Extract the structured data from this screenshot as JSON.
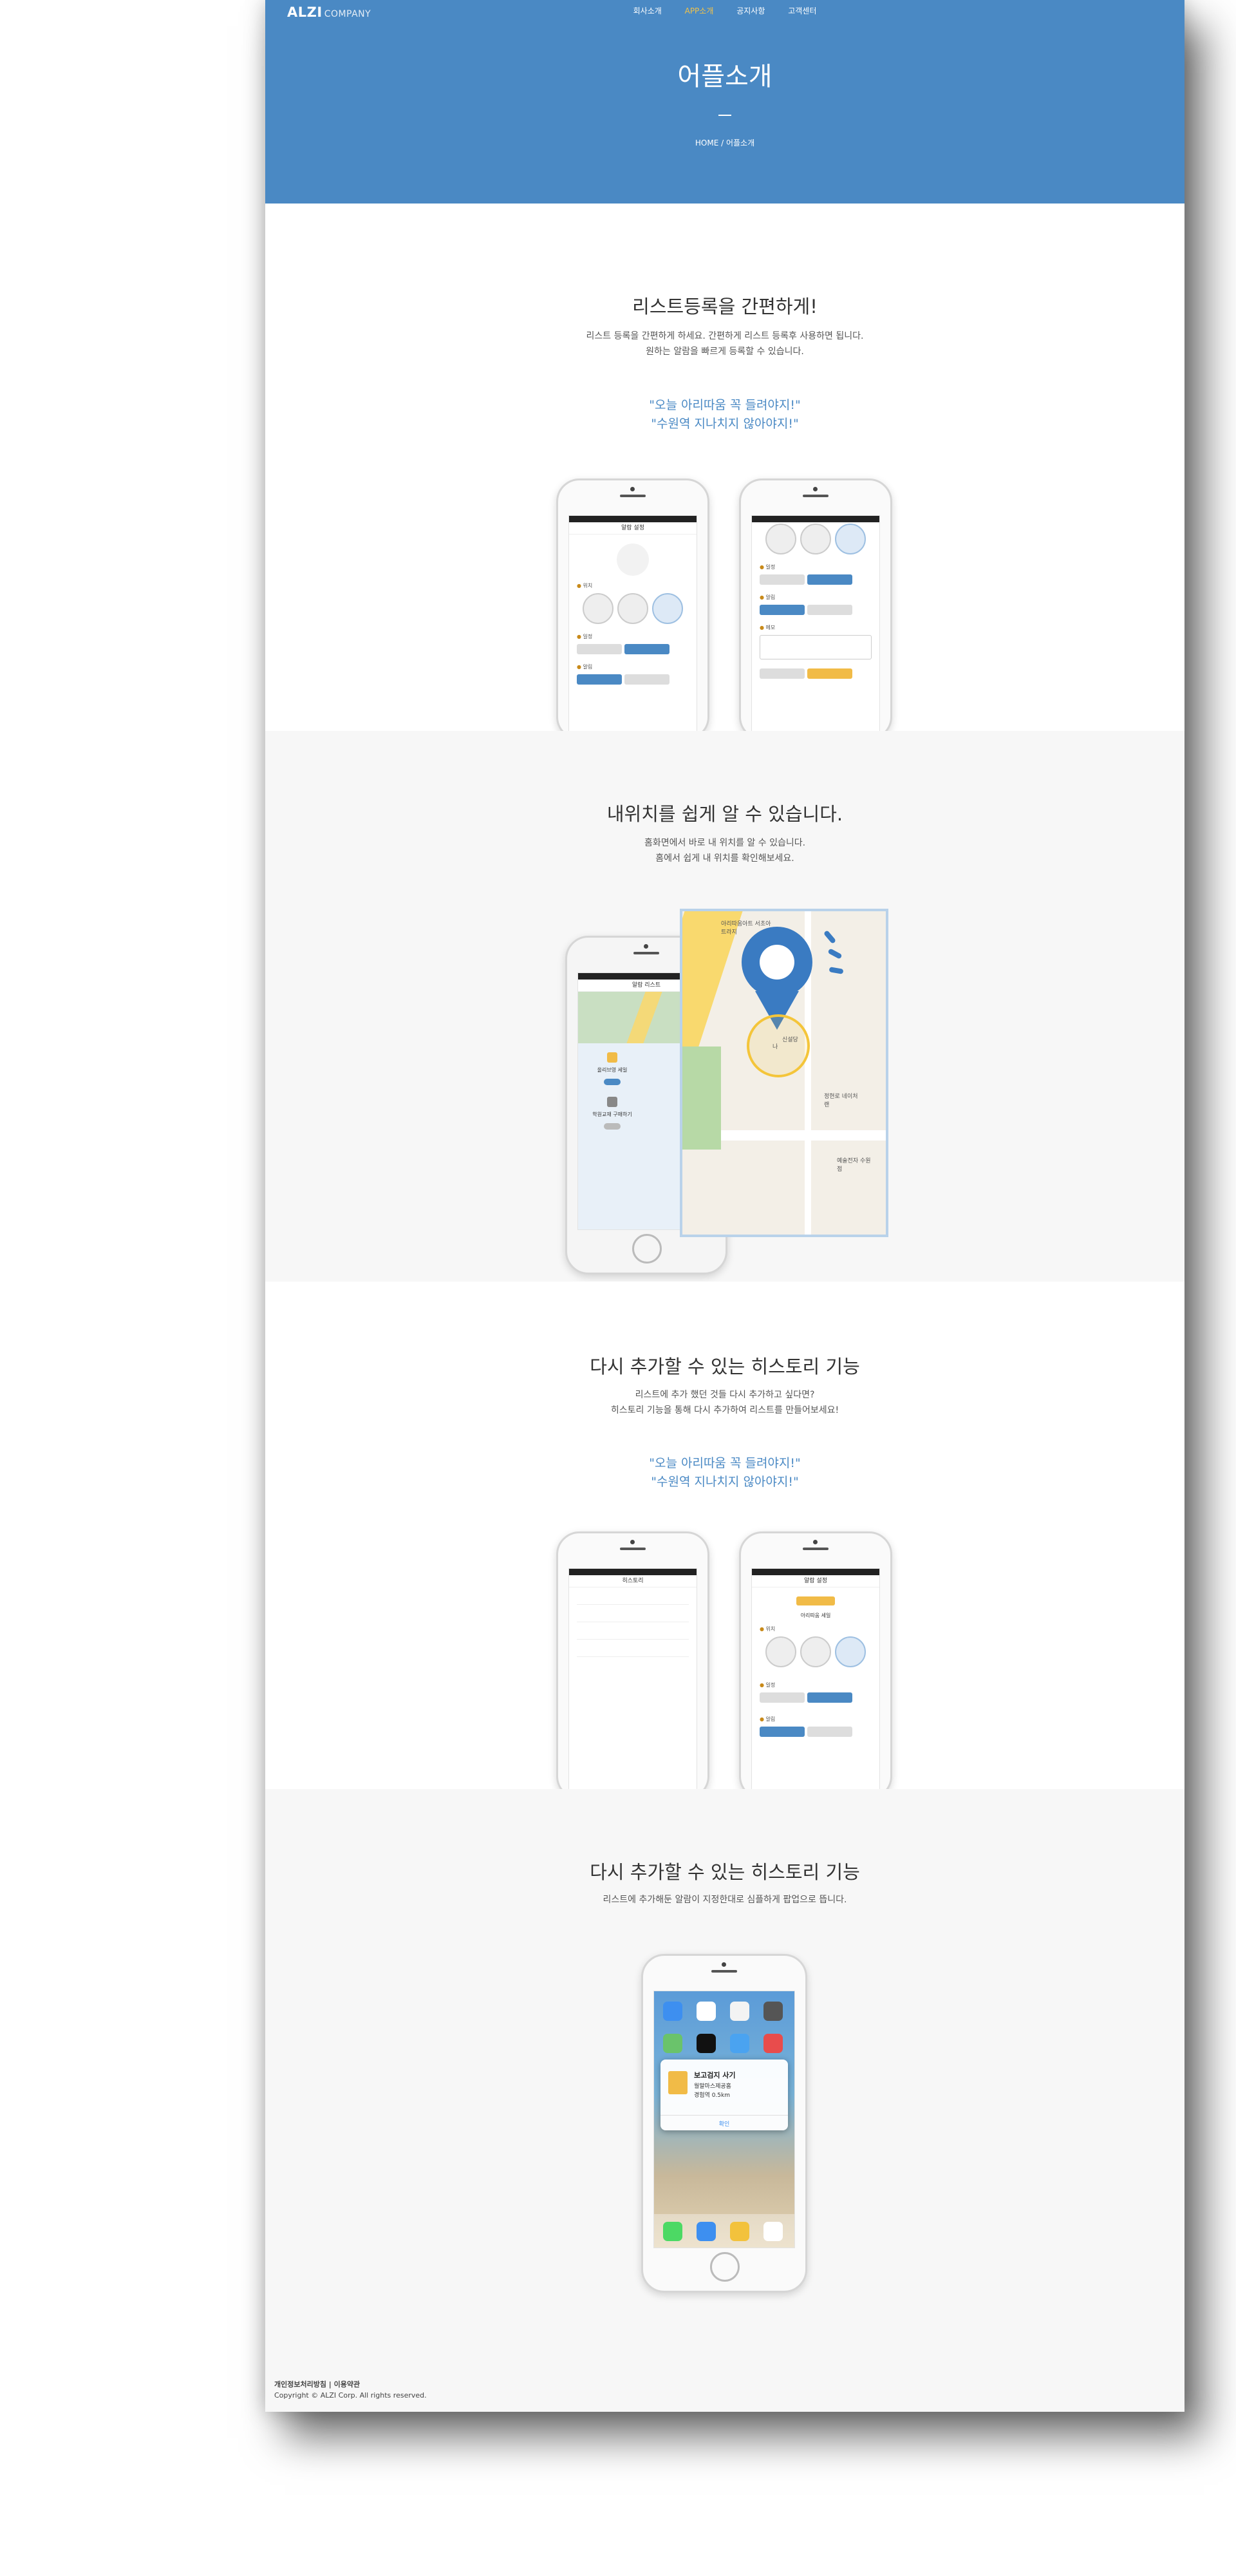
{
  "header": {
    "logo": "ALZI",
    "logo_sub": "COMPANY",
    "nav": [
      "회사소개",
      "APP소개",
      "공지사항",
      "고객센터"
    ],
    "active_nav_index": 1,
    "title": "어플소개",
    "breadcrumb": "HOME / 어플소개"
  },
  "colors": {
    "primary": "#4a89c4",
    "accent": "#f0c24b",
    "section_alt_bg": "#f7f7f7"
  },
  "section1": {
    "title": "리스트등록을 간편하게!",
    "desc_line1": "리스트 등록을 간편하게 하세요. 간편하게 리스트 등록후 사용하면 됩니다.",
    "desc_line2": "원하는 알람을 빠르게 등록할 수 있습니다.",
    "quote_line1": "\"오늘 아리따움 꼭 들려야지!\"",
    "quote_line2": "\"수원역 지나치지 않아야지!\"",
    "phone1_title": "알람 설정"
  },
  "section2": {
    "title": "내위치를 쉽게 알 수 있습니다.",
    "desc_line1": "홈화면에서 바로 내 위치를 알 수 있습니다.",
    "desc_line2": "홈에서 쉽게 내 위치를 확인해보세요.",
    "phone_title": "알람 리스트",
    "list_item1": "올리브영 세일",
    "list_item2": "학원교재 구매하기",
    "map_label_top": "아리따움아트 서초아트라지",
    "map_label_me": "나",
    "map_label_mid": "신설당",
    "map_label_right1": "정현로 네이처랜",
    "map_label_right2": "예술전자 수원점"
  },
  "section3": {
    "title": "다시 추가할 수 있는 히스토리 기능",
    "desc_line1": "리스트에 추가 했던 것들 다시 추가하고 싶다면?",
    "desc_line2": "히스토리 기능을 통해 다시 추가하여 리스트를 만들어보세요!",
    "quote_line1": "\"오늘 아리따움 꼭 들려야지!\"",
    "quote_line2": "\"수원역 지나치지 않아야지!\"",
    "phone1_title": "히스토리",
    "phone2_title": "알람 설정",
    "phone2_item": "아리따움 세일"
  },
  "section4": {
    "title": "다시 추가할 수 있는 히스토리 기능",
    "desc_line1": "리스트에 추가해둔 알람이 지정한대로 심플하게 팝업으로 뜹니다.",
    "notif_title": "보고검지 사기",
    "notif_sub": "월말마스제공홈",
    "notif_dist": "경험역 0.5km",
    "notif_ok": "확인"
  },
  "footer": {
    "links": "개인정보처리방침 | 이용약관",
    "copyright": "Copyright © ALZI Corp. All rights reserved."
  }
}
